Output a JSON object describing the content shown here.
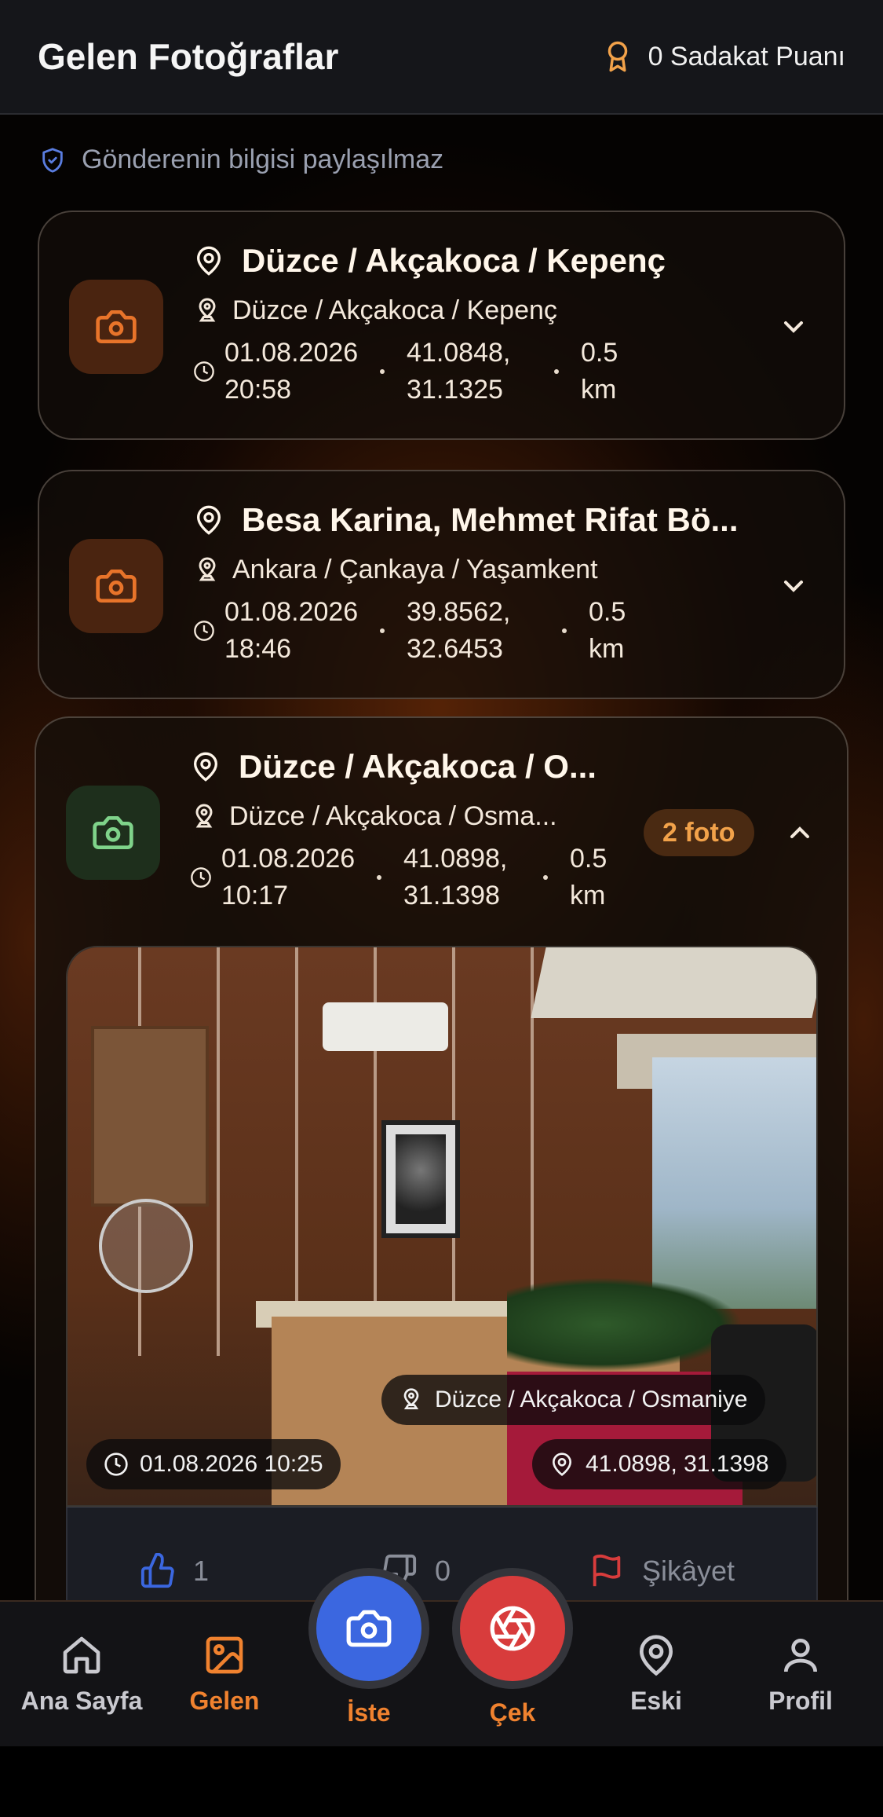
{
  "header": {
    "title": "Gelen Fotoğraflar",
    "points_label": "0 Sadakat Puanı"
  },
  "privacy_note": "Gönderenin bilgisi paylaşılmaz",
  "cards": [
    {
      "title": "Düzce / Akçakoca / Kepenç",
      "subtitle": "Düzce / Akçakoca / Kepenç",
      "date": "01.08.2026",
      "time": "20:58",
      "coord_lat": "41.0848,",
      "coord_lon": "31.1325",
      "dist_value": "0.5",
      "dist_unit": "km",
      "icon_color": "#e8742a"
    },
    {
      "title": "Besa Karina, Mehmet Rifat Bö...",
      "subtitle": "Ankara / Çankaya / Yaşamkent",
      "date": "01.08.2026",
      "time": "18:46",
      "coord_lat": "39.8562,",
      "coord_lon": "32.6453",
      "dist_value": "0.5",
      "dist_unit": "km",
      "icon_color": "#e8742a"
    },
    {
      "title": "Düzce / Akçakoca / O...",
      "subtitle": "Düzce / Akçakoca / Osma...",
      "date": "01.08.2026",
      "time": "10:17",
      "coord_lat": "41.0898,",
      "coord_lon": "31.1398",
      "dist_value": "0.5",
      "dist_unit": "km",
      "badge": "2 foto",
      "icon_color": "#7fd38a"
    }
  ],
  "photo": {
    "location": "Düzce / Akçakoca / Osmaniye",
    "timestamp": "01.08.2026 10:25",
    "coords": "41.0898, 31.1398"
  },
  "actions": {
    "likes": "1",
    "dislikes": "0",
    "report": "Şikâyet"
  },
  "nav": {
    "home": "Ana Sayfa",
    "incoming": "Gelen",
    "request": "İste",
    "capture": "Çek",
    "old": "Eski",
    "profile": "Profil"
  },
  "colors": {
    "accent": "#f0822f",
    "fab_blue": "#3b67e0",
    "fab_red": "#d83c3c",
    "badge_text": "#f2a24a"
  }
}
